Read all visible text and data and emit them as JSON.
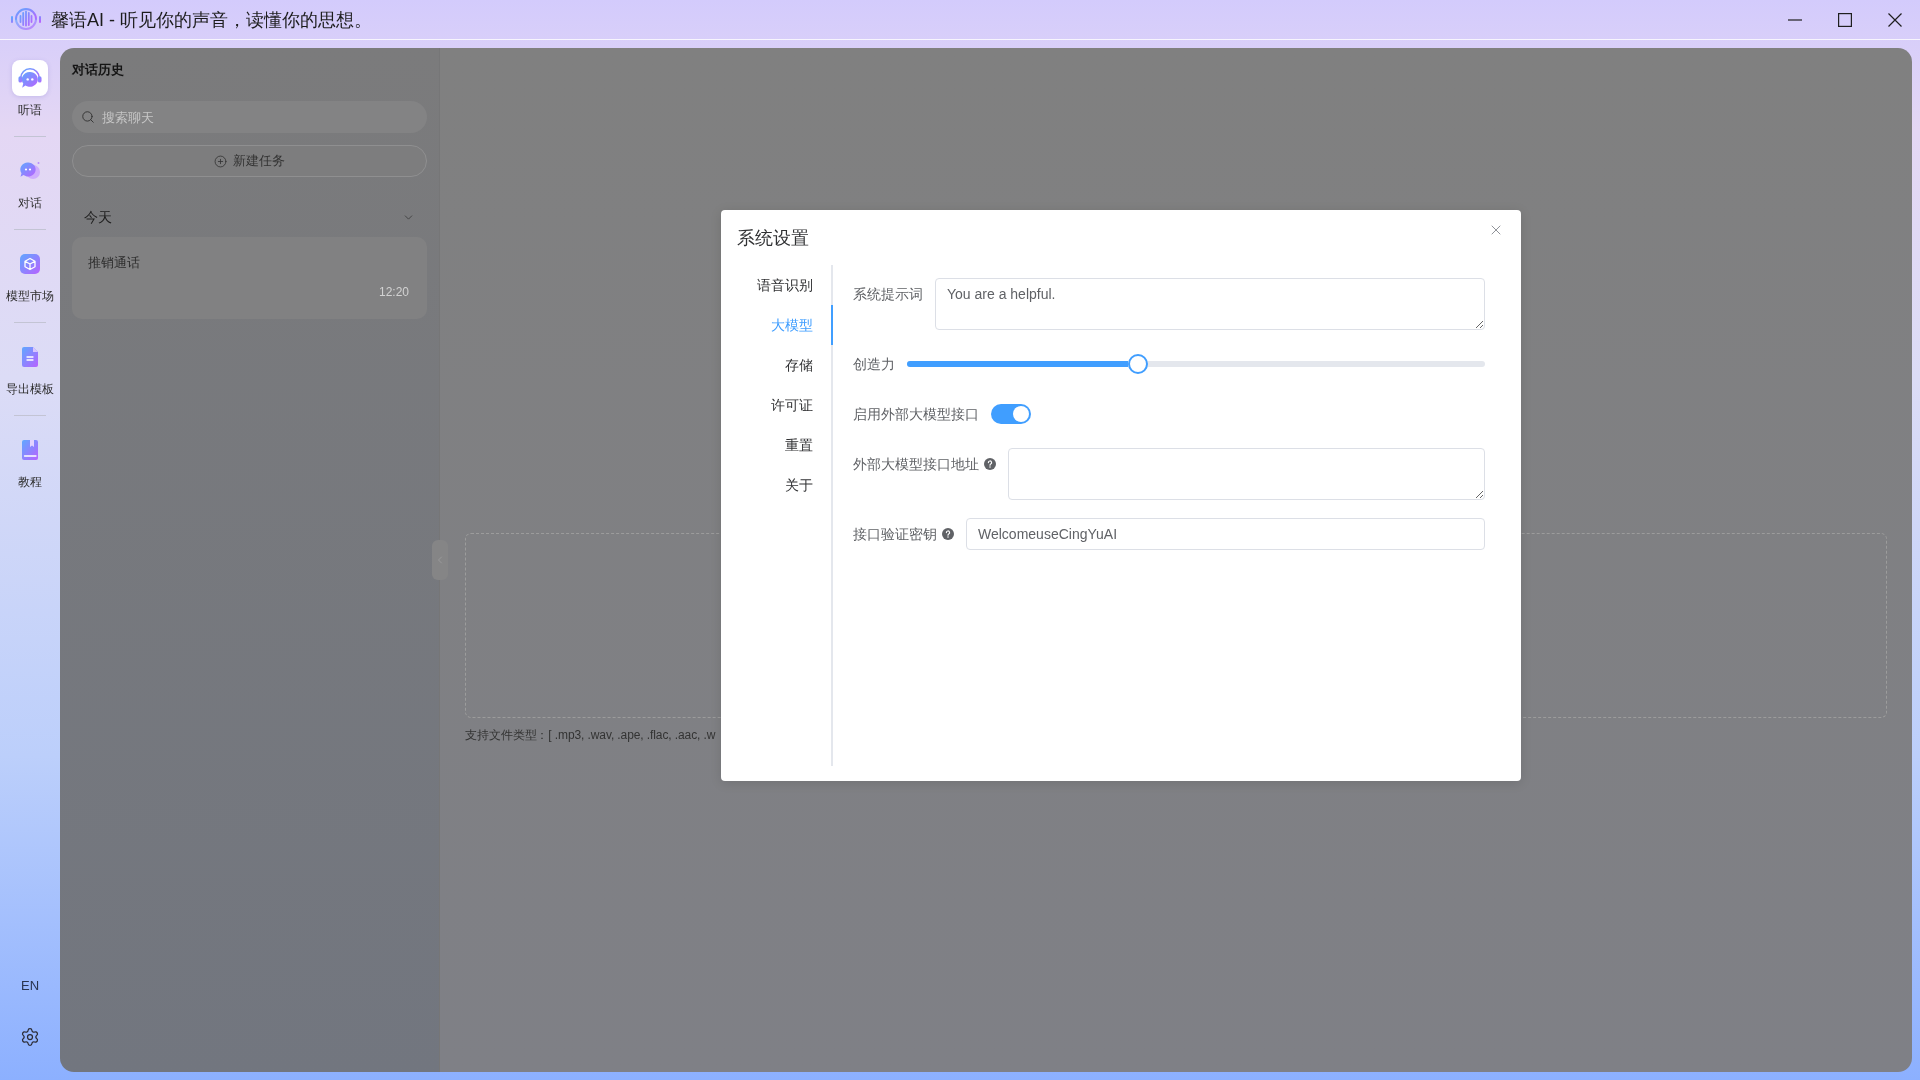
{
  "window": {
    "title": "馨语AI - 听见你的声音，读懂你的思想。"
  },
  "nav_rail": {
    "items": [
      {
        "label": "听语",
        "selected": true
      },
      {
        "label": "对话",
        "selected": false
      },
      {
        "label": "模型市场",
        "selected": false
      },
      {
        "label": "导出模板",
        "selected": false
      },
      {
        "label": "教程",
        "selected": false
      }
    ],
    "language": "EN"
  },
  "history": {
    "title": "对话历史",
    "search": {
      "placeholder": "搜索聊天"
    },
    "new_button": "新建任务",
    "groups": [
      {
        "label": "今天",
        "expanded": true,
        "items": [
          {
            "title": "推销通话",
            "time": "12:20"
          }
        ]
      }
    ]
  },
  "upload": {
    "formats_hint": "支持文件类型：[ .mp3, .wav, .ape, .flac, .aac, .w"
  },
  "dialog": {
    "title": "系统设置",
    "tabs": [
      {
        "label": "语音识别",
        "selected": false
      },
      {
        "label": "大模型",
        "selected": true
      },
      {
        "label": "存储",
        "selected": false
      },
      {
        "label": "许可证",
        "selected": false
      },
      {
        "label": "重置",
        "selected": false
      },
      {
        "label": "关于",
        "selected": false
      }
    ],
    "fields": [
      {
        "kind": "textarea",
        "label": "系统提示词",
        "help": false,
        "value": "You are a helpful."
      },
      {
        "kind": "slider",
        "label": "创造力",
        "help": false,
        "level": 0.4
      },
      {
        "kind": "switch",
        "label": "启用外部大模型接口",
        "help": false,
        "on": true
      },
      {
        "kind": "textarea",
        "label": "外部大模型接口地址",
        "help": true
      },
      {
        "kind": "input",
        "label": "接口验证密钥",
        "help": true,
        "value": "WelcomeuseCingYuAI"
      }
    ]
  }
}
